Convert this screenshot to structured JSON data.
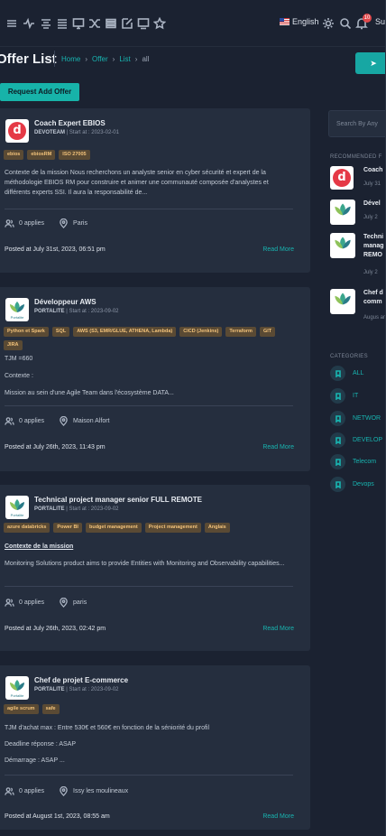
{
  "header": {
    "language": "English",
    "notification_count": "10",
    "user_label": "Sup",
    "toolbar_icons": [
      "menu-icon",
      "activity-icon",
      "align-icon",
      "list-icon",
      "monitor-icon",
      "shuffle-icon",
      "layers-icon",
      "edit-icon",
      "desktop-icon",
      "star-icon"
    ]
  },
  "page": {
    "title": "Offer List",
    "breadcrumb": [
      "Home",
      "Offer",
      "List",
      "all"
    ],
    "request_button": "Request Add Offer"
  },
  "offers": [
    {
      "title": "Coach Expert EBIOS",
      "company": "DEVOTEAM",
      "start": "| Start at : 2023-02-01",
      "tags": [
        "ebios",
        "ebiosRM",
        "ISO 27005"
      ],
      "description": "Contexte de la mission Nous recherchons un analyste senior en cyber sécurité et expert de la méthodologie EBIOS RM pour construire et animer une communauté composée d'analystes et différents experts SSI. Il aura la responsabilité de...",
      "applies": "0 applies",
      "location": "Paris",
      "posted": "Posted at July 31st, 2023, 06:51 pm",
      "read_more": "Read More"
    },
    {
      "title": "Développeur AWS",
      "company": "PORTALITE",
      "start": "| Start at : 2023-09-02",
      "tags": [
        "Python et Spark",
        "SQL",
        "AWS (S3, EMR/GLUE, ATHENA, Lambda)",
        "CICD (Jenkins)",
        "Terraform",
        "GIT",
        "JIRA"
      ],
      "lines": [
        "TJM =660",
        "Contexte :",
        "Mission au sein d'une Agile Team dans l'écosystème DATA..."
      ],
      "applies": "0 applies",
      "location": "Maison Alfort",
      "posted": "Posted at July 26th, 2023, 11:43 pm",
      "read_more": "Read More"
    },
    {
      "title": "Technical project manager senior FULL REMOTE",
      "company": "PORTALITE",
      "start": "| Start at : 2023-09-02",
      "tags": [
        "azure databricks",
        "Power BI",
        "budget management",
        "Project management",
        "Anglais"
      ],
      "heading": "Contexte de la mission",
      "description": "Monitoring Solutions product aims to provide Entities with Monitoring and Observability capabilities...",
      "applies": "0 applies",
      "location": "paris",
      "posted": "Posted at July 26th, 2023, 02:42 pm",
      "read_more": "Read More"
    },
    {
      "title": "Chef de projet E-commerce",
      "company": "PORTALITE",
      "start": "| Start at : 2023-09-02",
      "tags": [
        "agile scrum",
        "safe"
      ],
      "lines": [
        "TJM d'achat max : Entre 530€ et 560€ en fonction de la séniorité du profil",
        "Deadline réponse : ASAP",
        "Démarrage : ASAP ..."
      ],
      "applies": "0 applies",
      "location": "Issy les moulineaux",
      "posted": "Posted at August 1st, 2023, 08:55 am",
      "read_more": "Read More"
    }
  ],
  "sidebar": {
    "search_placeholder": "Search By Any",
    "recommended_title": "RECOMMENDED F",
    "recommended": [
      {
        "title": "Coach",
        "date": "July 31"
      },
      {
        "title": "Dével",
        "date": "July 2"
      },
      {
        "title": "Techni manag REMO",
        "date": "July 2"
      },
      {
        "title": "Chef d comm",
        "date": "Augus am"
      }
    ],
    "categories_title": "CATEGORIES",
    "categories": [
      "ALL",
      "IT",
      "NETWOR",
      "DEVELOP",
      "Telecom",
      "Devops"
    ]
  },
  "colors": {
    "accent": "#18b4b0",
    "tag_bg": "#5a4a34",
    "tag_text": "#f2c27a",
    "card_bg": "#252e3e",
    "page_bg": "#1b2231"
  }
}
